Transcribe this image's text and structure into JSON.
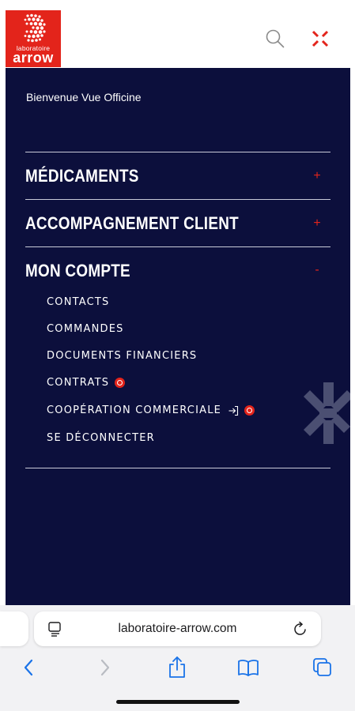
{
  "brand": {
    "logo_top": "laboratoire",
    "logo_main": "arrow",
    "color_red": "#e3241b",
    "color_navy": "#0c0f3c"
  },
  "header": {
    "search_icon": "search-icon",
    "close_icon": "close-icon"
  },
  "menu": {
    "welcome": "Bienvenue Vue Officine",
    "sections": [
      {
        "label": "MÉDICAMENTS",
        "toggle": "+"
      },
      {
        "label": "ACCOMPAGNEMENT CLIENT",
        "toggle": "+"
      },
      {
        "label": "MON COMPTE",
        "toggle": "-"
      }
    ],
    "account_items": [
      {
        "label": "CONTACTS"
      },
      {
        "label": "COMMANDES"
      },
      {
        "label": "DOCUMENTS FINANCIERS"
      },
      {
        "label": "CONTRATS"
      },
      {
        "label": "COOPÉRATION COMMERCIALE"
      },
      {
        "label": "SE DÉCONNECTER"
      }
    ]
  },
  "browser": {
    "url": "laboratoire-arrow.com",
    "icons": [
      "reader-icon",
      "reload-icon",
      "back-icon",
      "forward-icon",
      "share-icon",
      "bookmarks-icon",
      "tabs-icon"
    ]
  }
}
